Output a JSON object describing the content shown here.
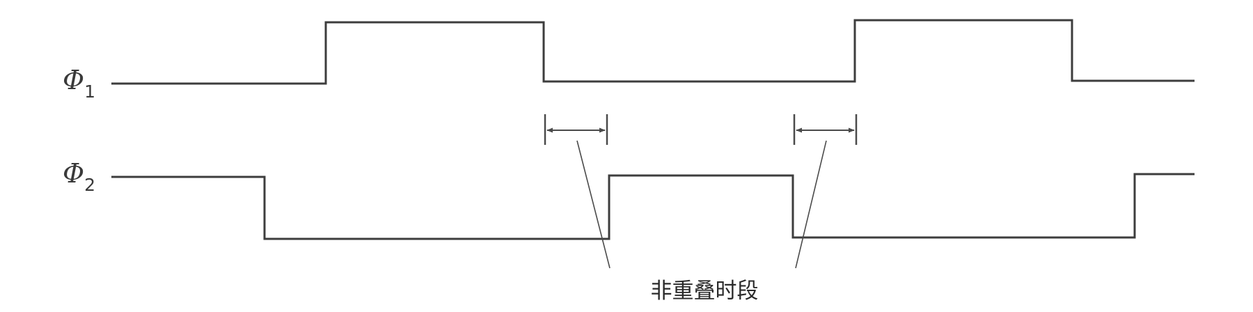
{
  "signals": [
    {
      "symbol": "Φ",
      "subscript": "1"
    },
    {
      "symbol": "Φ",
      "subscript": "2"
    }
  ],
  "caption": "非重叠时段"
}
